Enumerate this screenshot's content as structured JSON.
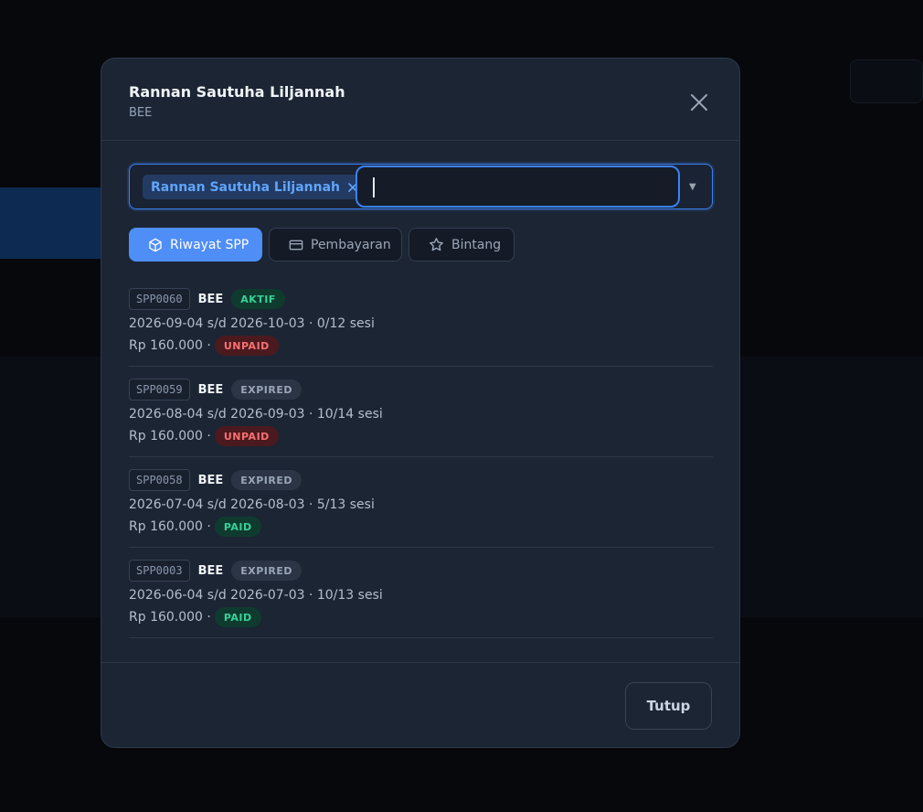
{
  "modal": {
    "title": "Rannan Sautuha Liljannah",
    "subtitle": "BEE"
  },
  "select": {
    "chip_label": "Rannan Sautuha Liljannah",
    "input_value": "",
    "input_placeholder": ""
  },
  "tabs": [
    {
      "label": "Riwayat SPP",
      "icon": "box-icon",
      "active": true
    },
    {
      "label": "Pembayaran",
      "icon": "credit-card-icon",
      "active": false
    },
    {
      "label": "Bintang",
      "icon": "star-icon",
      "active": false
    }
  ],
  "spp_items": [
    {
      "code": "SPP0060",
      "program": "BEE",
      "status": "AKTIF",
      "period": "2026-09-04 s/d 2026-10-03 · 0/12 sesi",
      "amount": "Rp 160.000 ·",
      "payment": "UNPAID"
    },
    {
      "code": "SPP0059",
      "program": "BEE",
      "status": "EXPIRED",
      "period": "2026-08-04 s/d 2026-09-03 · 10/14 sesi",
      "amount": "Rp 160.000 ·",
      "payment": "UNPAID"
    },
    {
      "code": "SPP0058",
      "program": "BEE",
      "status": "EXPIRED",
      "period": "2026-07-04 s/d 2026-08-03 · 5/13 sesi",
      "amount": "Rp 160.000 ·",
      "payment": "PAID"
    },
    {
      "code": "SPP0003",
      "program": "BEE",
      "status": "EXPIRED",
      "period": "2026-06-04 s/d 2026-07-03 · 10/13 sesi",
      "amount": "Rp 160.000 ·",
      "payment": "PAID"
    }
  ],
  "footer": {
    "close_label": "Tutup"
  },
  "colors": {
    "accent": "#4f8ef7",
    "success": "#34d399",
    "danger": "#f87171",
    "muted": "#9aa6b8"
  }
}
